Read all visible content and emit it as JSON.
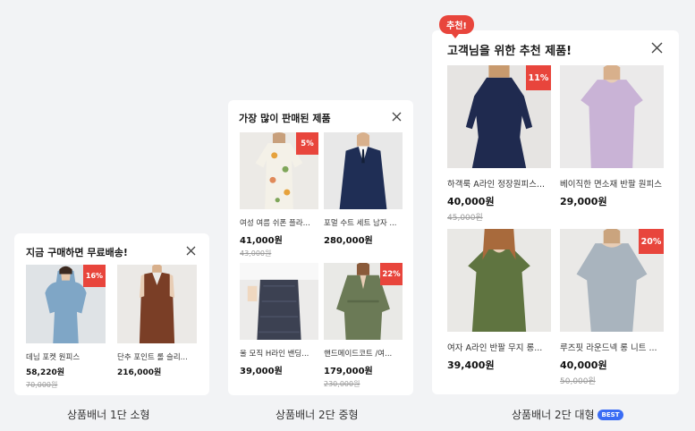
{
  "colors": {
    "discount_badge": "#e8453c",
    "best_badge": "#3a6cf4",
    "background": "#f2f3f5"
  },
  "small_banner": {
    "title": "지금 구매하면 무료배송!",
    "close_icon": "close-icon",
    "caption": "상품배너 1단 소형",
    "products": [
      {
        "name": "데님 포켓 원피스",
        "price": "58,220원",
        "original_price": "70,000원",
        "discount": "16%"
      },
      {
        "name": "단추 포인트 롤 슬리...",
        "price": "216,000원"
      }
    ]
  },
  "medium_banner": {
    "title": "가장 많이 판매된 제품",
    "close_icon": "close-icon",
    "caption": "상품배너 2단 중형",
    "products": [
      {
        "name": "여성 여름 쉬폰 플라...",
        "price": "41,000원",
        "original_price": "43,000원",
        "discount": "5%"
      },
      {
        "name": "포멀 수트 세트 남자 ...",
        "price": "280,000원"
      },
      {
        "name": "울 모직 H라인 밴딩...",
        "price": "39,000원"
      },
      {
        "name": "핸드메이드코트 /여...",
        "price": "179,000원",
        "original_price": "230,000원",
        "discount": "22%"
      }
    ]
  },
  "large_banner": {
    "badge": "추천!",
    "title": "고객님을 위한 추천 제품!",
    "close_icon": "close-icon",
    "caption": "상품배너 2단 대형",
    "caption_badge": "BEST",
    "products": [
      {
        "name": "하객룩 A라인 정장원피스...",
        "price": "40,000원",
        "original_price": "45,000원",
        "discount": "11%"
      },
      {
        "name": "베이직한 면소재 반팔 원피스",
        "price": "29,000원"
      },
      {
        "name": "여자 A라인 반팔 무지 롱...",
        "price": "39,400원"
      },
      {
        "name": "루즈핏 라운드넥 롱 니트 ...",
        "price": "40,000원",
        "original_price": "50,000원",
        "discount": "20%"
      }
    ]
  }
}
